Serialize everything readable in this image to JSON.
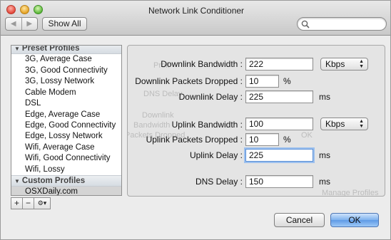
{
  "window": {
    "title": "Network Link Conditioner"
  },
  "toolbar": {
    "show_all": "Show All",
    "search_placeholder": ""
  },
  "sidebar": {
    "preset_header": "Preset Profiles",
    "preset_items": [
      "3G, Average Case",
      "3G, Good Connectivity",
      "3G, Lossy Network",
      "Cable Modem",
      "DSL",
      "Edge, Average Case",
      "Edge, Good Connectivity",
      "Edge, Lossy Network",
      "Wifi, Average Case",
      "Wifi, Good Connectivity",
      "Wifi, Lossy"
    ],
    "custom_header": "Custom Profiles",
    "custom_items": [
      "OSXDaily.com"
    ],
    "selected": "OSXDaily.com"
  },
  "sidebar_tools": {
    "add": "+",
    "remove": "−",
    "action": "⚙▾"
  },
  "form": {
    "downlink_bandwidth": {
      "label": "Downlink Bandwidth :",
      "value": "222",
      "unit": "Kbps"
    },
    "downlink_packets_dropped": {
      "label": "Downlink Packets Dropped :",
      "value": "10",
      "unit": "%"
    },
    "downlink_delay": {
      "label": "Downlink Delay :",
      "value": "225",
      "unit": "ms"
    },
    "uplink_bandwidth": {
      "label": "Uplink Bandwidth :",
      "value": "100",
      "unit": "Kbps"
    },
    "uplink_packets_dropped": {
      "label": "Uplink Packets Dropped :",
      "value": "10",
      "unit": "%"
    },
    "uplink_delay": {
      "label": "Uplink Delay :",
      "value": "225",
      "unit": "ms"
    },
    "dns_delay": {
      "label": "DNS Delay :",
      "value": "150",
      "unit": "ms"
    }
  },
  "background_ghost": {
    "profile": "Profi",
    "dns_delay": "DNS Delay",
    "bandwidth": "Bandwidth",
    "packets": "Packets Dropped",
    "downlink": "Downlink",
    "ok": "OK",
    "manage": "Manage Profiles"
  },
  "buttons": {
    "cancel": "Cancel",
    "ok": "OK"
  }
}
